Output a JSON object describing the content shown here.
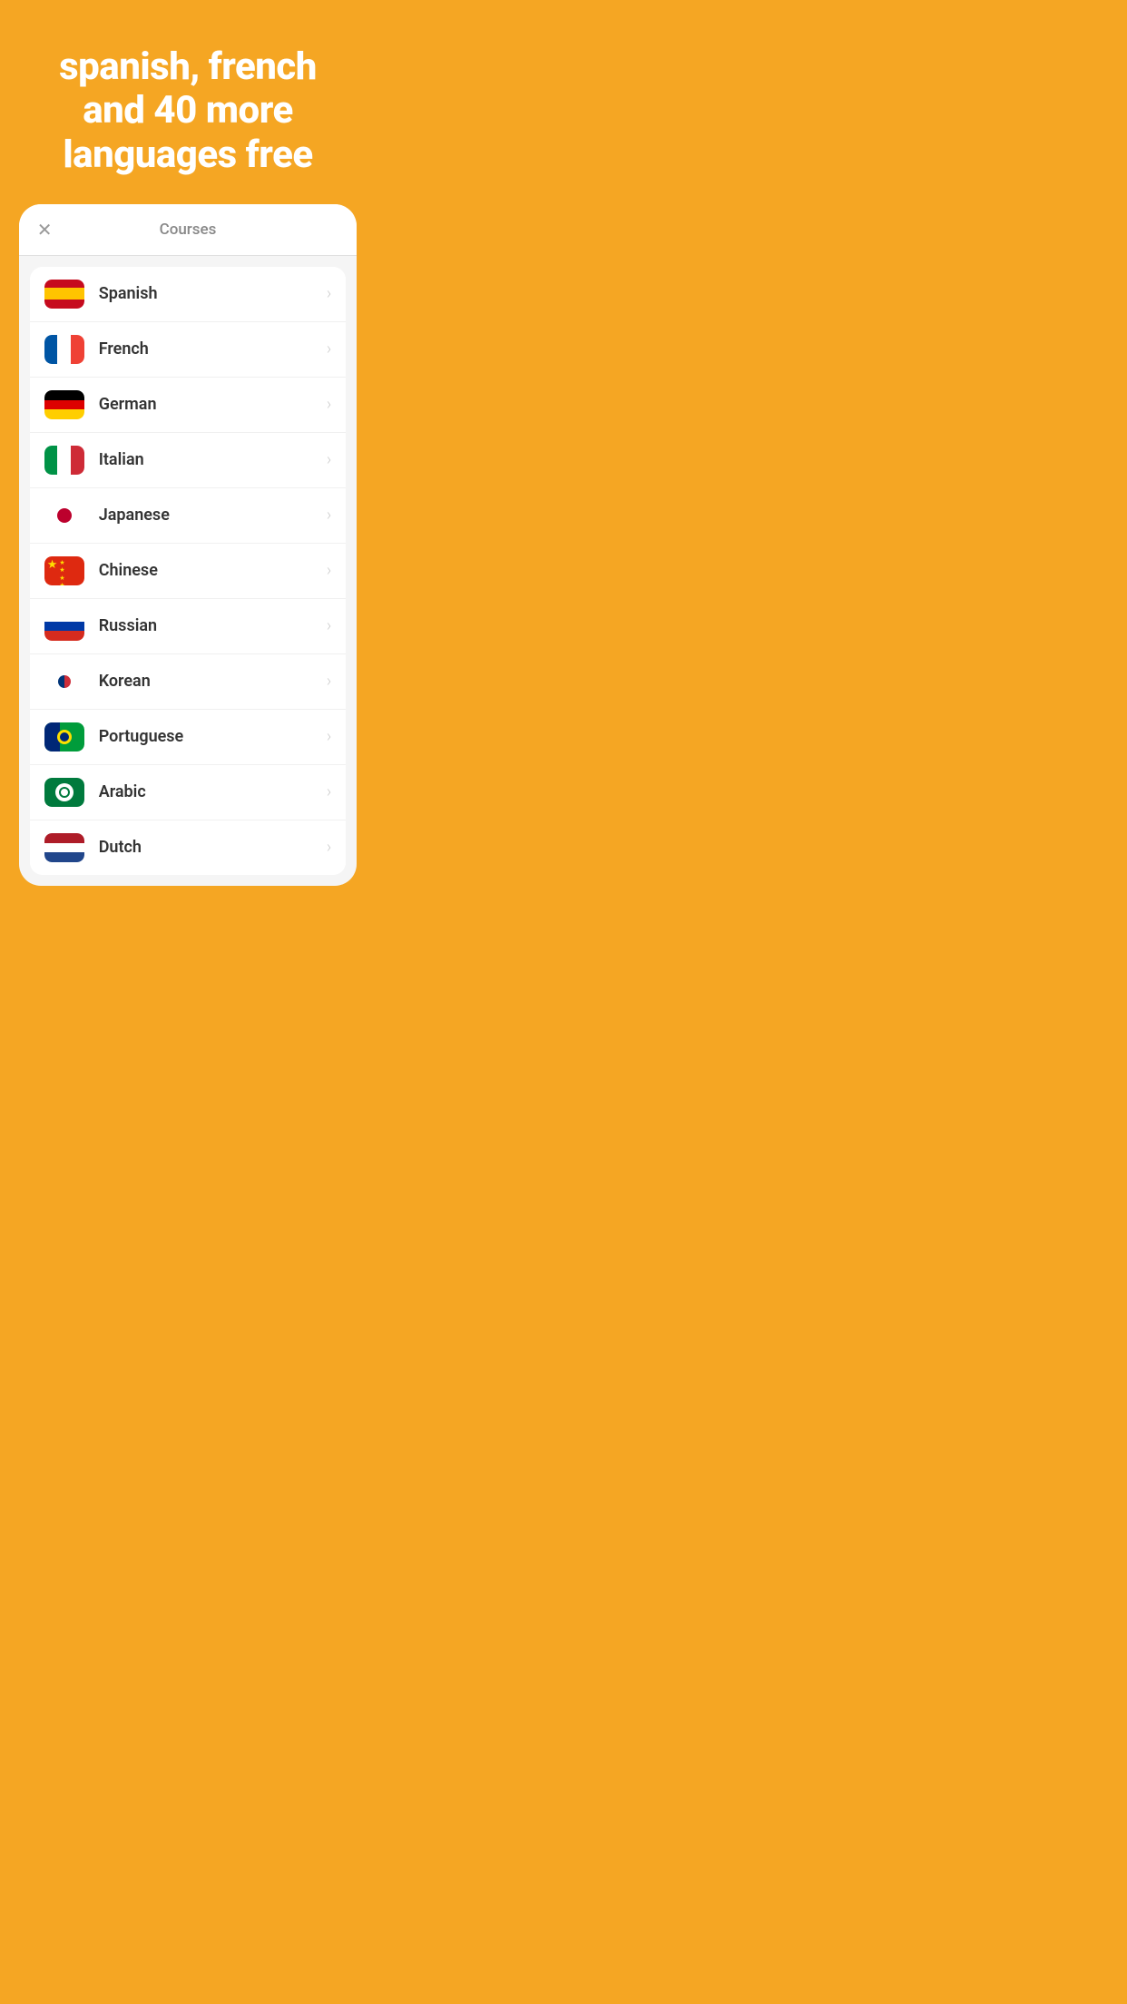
{
  "header": {
    "title": "spanish, french and 40 more languages free"
  },
  "modal": {
    "close_label": "✕",
    "title": "Courses",
    "languages": [
      {
        "id": "spanish",
        "name": "Spanish"
      },
      {
        "id": "french",
        "name": "French"
      },
      {
        "id": "german",
        "name": "German"
      },
      {
        "id": "italian",
        "name": "Italian"
      },
      {
        "id": "japanese",
        "name": "Japanese"
      },
      {
        "id": "chinese",
        "name": "Chinese"
      },
      {
        "id": "russian",
        "name": "Russian"
      },
      {
        "id": "korean",
        "name": "Korean"
      },
      {
        "id": "portuguese",
        "name": "Portuguese"
      },
      {
        "id": "arabic",
        "name": "Arabic"
      },
      {
        "id": "dutch",
        "name": "Dutch"
      }
    ]
  }
}
